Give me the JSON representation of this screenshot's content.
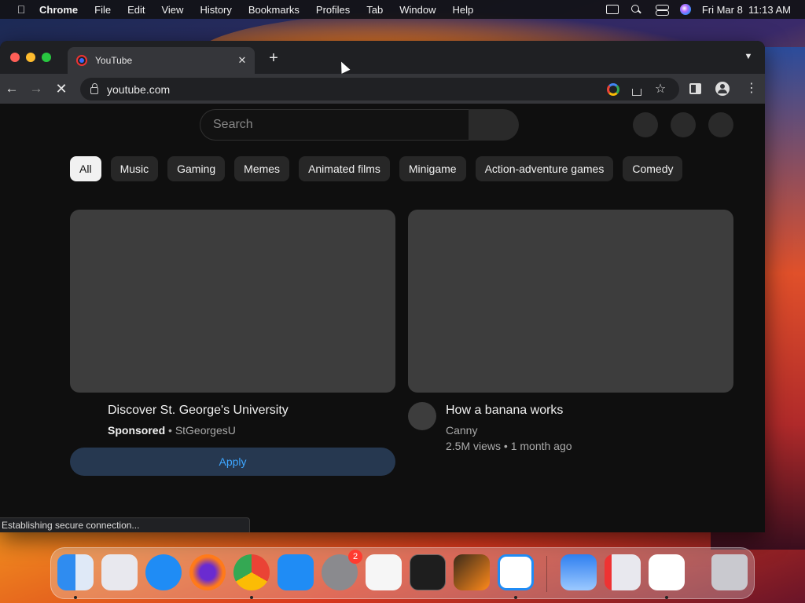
{
  "menubar": {
    "app_name": "Chrome",
    "items": [
      "File",
      "Edit",
      "View",
      "History",
      "Bookmarks",
      "Profiles",
      "Tab",
      "Window",
      "Help"
    ],
    "clock": "Fri Mar 8  11:13 AM"
  },
  "browser": {
    "tab_title": "YouTube",
    "new_tab_symbol": "+",
    "url": "youtube.com"
  },
  "youtube": {
    "search_placeholder": "Search",
    "chips": [
      "All",
      "Music",
      "Gaming",
      "Memes",
      "Animated films",
      "Minigame",
      "Action-adventure games",
      "Comedy"
    ],
    "active_chip_index": 0,
    "cards": [
      {
        "title": "Discover St. George's University",
        "sponsored_label": "Sponsored",
        "separator": " • ",
        "channel": "StGeorgesU",
        "cta": "Apply"
      },
      {
        "title": "How a banana works",
        "channel": "Canny",
        "stats": "2.5M views • 1 month ago"
      }
    ]
  },
  "status_text": "Establishing secure connection...",
  "dock": {
    "apps": [
      {
        "name": "finder-icon",
        "color": "#2f8cf0"
      },
      {
        "name": "launchpad-icon",
        "color": "#e8e8ee"
      },
      {
        "name": "safari-icon",
        "color": "#1f8cf5"
      },
      {
        "name": "firefox-icon",
        "color": "#ff7a1a"
      },
      {
        "name": "chrome-icon",
        "color": "#ffffff"
      },
      {
        "name": "app-store-icon",
        "color": "#1f8cf5"
      },
      {
        "name": "system-settings-icon",
        "color": "#8a8a8e"
      },
      {
        "name": "textedit-icon",
        "color": "#f6f6f6"
      },
      {
        "name": "terminal-icon",
        "color": "#1e1e1e"
      },
      {
        "name": "garageband-icon",
        "color": "#ff8a1a"
      },
      {
        "name": "vscode-icon",
        "color": "#ffffff"
      },
      {
        "name": "weather-icon",
        "color": "#2f7ff0"
      },
      {
        "name": "parallels-icon",
        "color": "#e8e8ee"
      },
      {
        "name": "pycharm-ce-icon",
        "color": "#ffffff"
      },
      {
        "name": "trash-icon",
        "color": "#c9c9cf"
      }
    ],
    "settings_badge": "2"
  }
}
